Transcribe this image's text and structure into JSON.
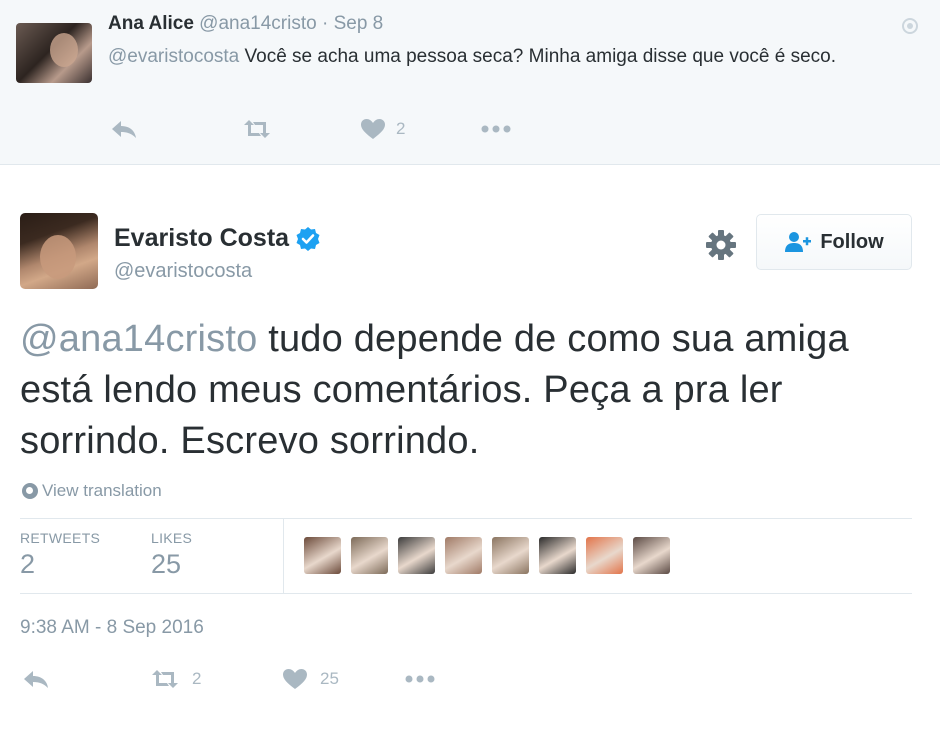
{
  "reply_tweet": {
    "name": "Ana Alice",
    "handle": "@ana14cristo",
    "separator": "·",
    "date": "Sep 8",
    "mention": "@evaristocosta",
    "text": "Você se acha uma pessoa seca?  Minha amiga disse que você é seco.",
    "likes": "2"
  },
  "main_tweet": {
    "name": "Evaristo Costa",
    "handle": "@evaristocosta",
    "follow_label": "Follow",
    "mention": "@ana14cristo",
    "text": "tudo depende de como sua amiga está lendo meus comentários. Peça a pra ler sorrindo. Escrevo sorrindo.",
    "view_translation": "View translation",
    "stats": {
      "retweets_label": "RETWEETS",
      "retweets": "2",
      "likes_label": "LIKES",
      "likes": "25"
    },
    "likers": [
      "#6b4a3a",
      "#7c6a58",
      "#3c3c3c",
      "#a07a66",
      "#8a7460",
      "#2b2b2b",
      "#e2744a",
      "#5b4a44"
    ],
    "timestamp": "9:38 AM - 8 Sep 2016",
    "action_retweets": "2",
    "action_likes": "25"
  },
  "colors": {
    "muted": "#8899a6",
    "text": "#292f33",
    "verified": "#1da1f2",
    "follow_icon": "#1b95e0"
  }
}
